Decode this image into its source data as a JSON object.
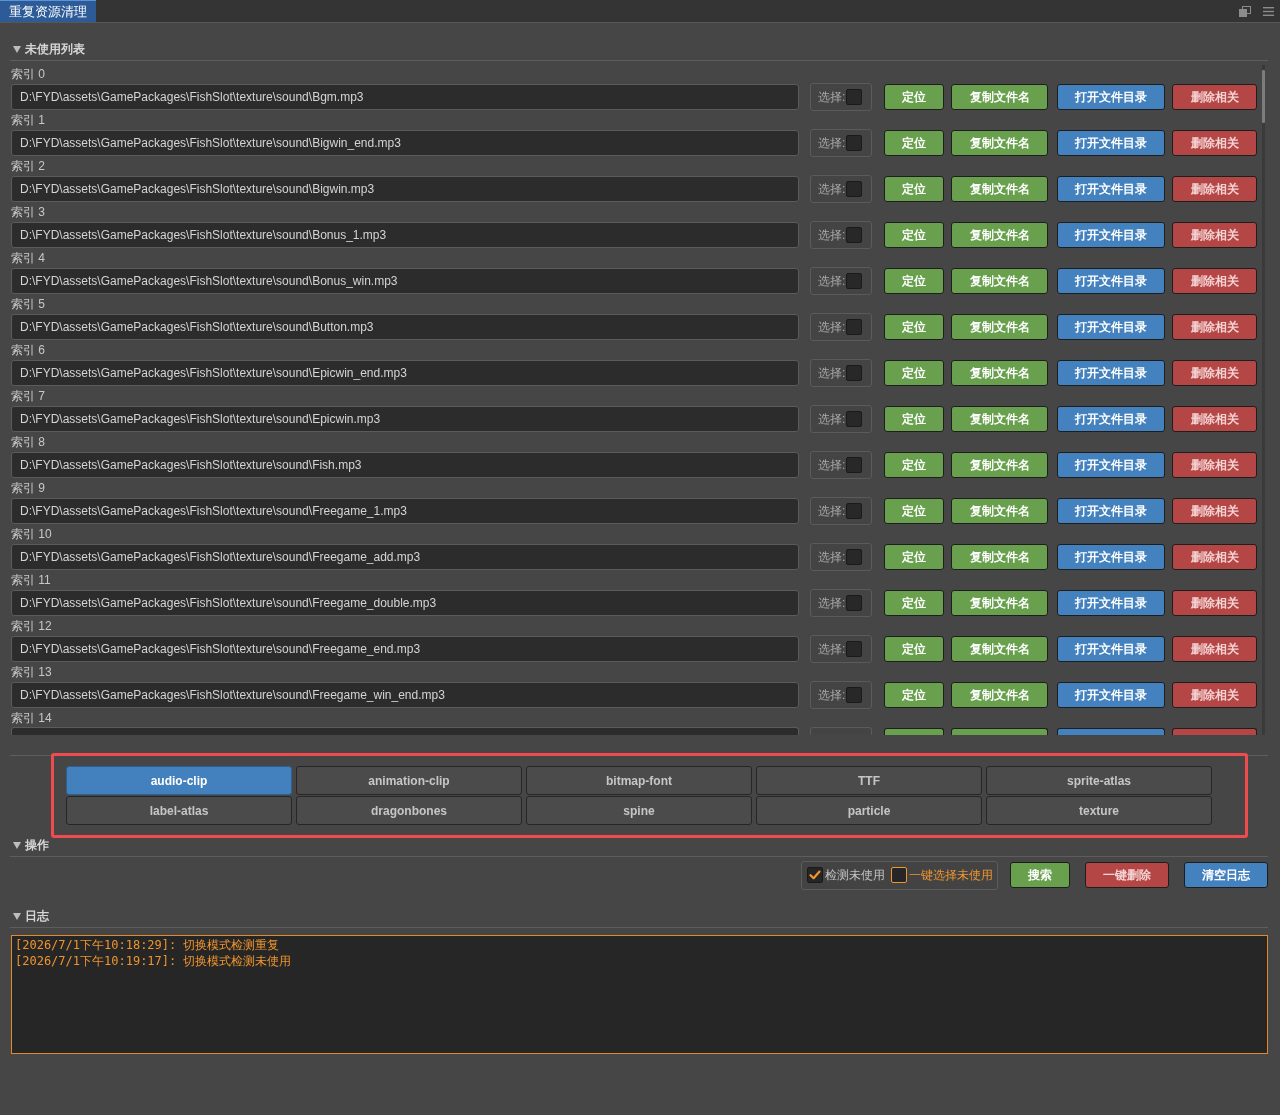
{
  "window": {
    "tabs": [
      {
        "label": "重复资源清理",
        "selected": true
      }
    ]
  },
  "unused_list": {
    "title": "未使用列表",
    "expanded": true,
    "rows": [
      {
        "index": "索引 0",
        "cut_off": false,
        "path": "D:\\FYD\\assets\\GamePackages\\FishSlot\\texture\\sound\\Bgm.mp3",
        "select_label": "选择:",
        "checked": false,
        "buttons": [
          {
            "label": "定位",
            "kind": "locate"
          },
          {
            "label": "复制文件名",
            "kind": "copy_name"
          },
          {
            "label": "打开文件目录",
            "kind": "open_dir"
          },
          {
            "label": "删除相关",
            "kind": "delete_related"
          }
        ]
      },
      {
        "index": "索引 1",
        "cut_off": false,
        "path": "D:\\FYD\\assets\\GamePackages\\FishSlot\\texture\\sound\\Bigwin_end.mp3",
        "select_label": "选择:",
        "checked": false,
        "buttons": [
          {
            "label": "定位",
            "kind": "locate"
          },
          {
            "label": "复制文件名",
            "kind": "copy_name"
          },
          {
            "label": "打开文件目录",
            "kind": "open_dir"
          },
          {
            "label": "删除相关",
            "kind": "delete_related"
          }
        ]
      },
      {
        "index": "索引 2",
        "cut_off": false,
        "path": "D:\\FYD\\assets\\GamePackages\\FishSlot\\texture\\sound\\Bigwin.mp3",
        "select_label": "选择:",
        "checked": false,
        "buttons": [
          {
            "label": "定位",
            "kind": "locate"
          },
          {
            "label": "复制文件名",
            "kind": "copy_name"
          },
          {
            "label": "打开文件目录",
            "kind": "open_dir"
          },
          {
            "label": "删除相关",
            "kind": "delete_related"
          }
        ]
      },
      {
        "index": "索引 3",
        "cut_off": false,
        "path": "D:\\FYD\\assets\\GamePackages\\FishSlot\\texture\\sound\\Bonus_1.mp3",
        "select_label": "选择:",
        "checked": false,
        "buttons": [
          {
            "label": "定位",
            "kind": "locate"
          },
          {
            "label": "复制文件名",
            "kind": "copy_name"
          },
          {
            "label": "打开文件目录",
            "kind": "open_dir"
          },
          {
            "label": "删除相关",
            "kind": "delete_related"
          }
        ]
      },
      {
        "index": "索引 4",
        "cut_off": false,
        "path": "D:\\FYD\\assets\\GamePackages\\FishSlot\\texture\\sound\\Bonus_win.mp3",
        "select_label": "选择:",
        "checked": false,
        "buttons": [
          {
            "label": "定位",
            "kind": "locate"
          },
          {
            "label": "复制文件名",
            "kind": "copy_name"
          },
          {
            "label": "打开文件目录",
            "kind": "open_dir"
          },
          {
            "label": "删除相关",
            "kind": "delete_related"
          }
        ]
      },
      {
        "index": "索引 5",
        "cut_off": false,
        "path": "D:\\FYD\\assets\\GamePackages\\FishSlot\\texture\\sound\\Button.mp3",
        "select_label": "选择:",
        "checked": false,
        "buttons": [
          {
            "label": "定位",
            "kind": "locate"
          },
          {
            "label": "复制文件名",
            "kind": "copy_name"
          },
          {
            "label": "打开文件目录",
            "kind": "open_dir"
          },
          {
            "label": "删除相关",
            "kind": "delete_related"
          }
        ]
      },
      {
        "index": "索引 6",
        "cut_off": false,
        "path": "D:\\FYD\\assets\\GamePackages\\FishSlot\\texture\\sound\\Epicwin_end.mp3",
        "select_label": "选择:",
        "checked": false,
        "buttons": [
          {
            "label": "定位",
            "kind": "locate"
          },
          {
            "label": "复制文件名",
            "kind": "copy_name"
          },
          {
            "label": "打开文件目录",
            "kind": "open_dir"
          },
          {
            "label": "删除相关",
            "kind": "delete_related"
          }
        ]
      },
      {
        "index": "索引 7",
        "cut_off": false,
        "path": "D:\\FYD\\assets\\GamePackages\\FishSlot\\texture\\sound\\Epicwin.mp3",
        "select_label": "选择:",
        "checked": false,
        "buttons": [
          {
            "label": "定位",
            "kind": "locate"
          },
          {
            "label": "复制文件名",
            "kind": "copy_name"
          },
          {
            "label": "打开文件目录",
            "kind": "open_dir"
          },
          {
            "label": "删除相关",
            "kind": "delete_related"
          }
        ]
      },
      {
        "index": "索引 8",
        "cut_off": false,
        "path": "D:\\FYD\\assets\\GamePackages\\FishSlot\\texture\\sound\\Fish.mp3",
        "select_label": "选择:",
        "checked": false,
        "buttons": [
          {
            "label": "定位",
            "kind": "locate"
          },
          {
            "label": "复制文件名",
            "kind": "copy_name"
          },
          {
            "label": "打开文件目录",
            "kind": "open_dir"
          },
          {
            "label": "删除相关",
            "kind": "delete_related"
          }
        ]
      },
      {
        "index": "索引 9",
        "cut_off": false,
        "path": "D:\\FYD\\assets\\GamePackages\\FishSlot\\texture\\sound\\Freegame_1.mp3",
        "select_label": "选择:",
        "checked": false,
        "buttons": [
          {
            "label": "定位",
            "kind": "locate"
          },
          {
            "label": "复制文件名",
            "kind": "copy_name"
          },
          {
            "label": "打开文件目录",
            "kind": "open_dir"
          },
          {
            "label": "删除相关",
            "kind": "delete_related"
          }
        ]
      },
      {
        "index": "索引 10",
        "cut_off": false,
        "path": "D:\\FYD\\assets\\GamePackages\\FishSlot\\texture\\sound\\Freegame_add.mp3",
        "select_label": "选择:",
        "checked": false,
        "buttons": [
          {
            "label": "定位",
            "kind": "locate"
          },
          {
            "label": "复制文件名",
            "kind": "copy_name"
          },
          {
            "label": "打开文件目录",
            "kind": "open_dir"
          },
          {
            "label": "删除相关",
            "kind": "delete_related"
          }
        ]
      },
      {
        "index": "索引 11",
        "cut_off": false,
        "path": "D:\\FYD\\assets\\GamePackages\\FishSlot\\texture\\sound\\Freegame_double.mp3",
        "select_label": "选择:",
        "checked": false,
        "buttons": [
          {
            "label": "定位",
            "kind": "locate"
          },
          {
            "label": "复制文件名",
            "kind": "copy_name"
          },
          {
            "label": "打开文件目录",
            "kind": "open_dir"
          },
          {
            "label": "删除相关",
            "kind": "delete_related"
          }
        ]
      },
      {
        "index": "索引 12",
        "cut_off": false,
        "path": "D:\\FYD\\assets\\GamePackages\\FishSlot\\texture\\sound\\Freegame_end.mp3",
        "select_label": "选择:",
        "checked": false,
        "buttons": [
          {
            "label": "定位",
            "kind": "locate"
          },
          {
            "label": "复制文件名",
            "kind": "copy_name"
          },
          {
            "label": "打开文件目录",
            "kind": "open_dir"
          },
          {
            "label": "删除相关",
            "kind": "delete_related"
          }
        ]
      },
      {
        "index": "索引 13",
        "cut_off": false,
        "path": "D:\\FYD\\assets\\GamePackages\\FishSlot\\texture\\sound\\Freegame_win_end.mp3",
        "select_label": "选择:",
        "checked": false,
        "buttons": [
          {
            "label": "定位",
            "kind": "locate"
          },
          {
            "label": "复制文件名",
            "kind": "copy_name"
          },
          {
            "label": "打开文件目录",
            "kind": "open_dir"
          },
          {
            "label": "删除相关",
            "kind": "delete_related"
          }
        ]
      },
      {
        "index": "索引 14",
        "cut_off": true,
        "buttons": [
          {
            "kind": "locate"
          },
          {
            "kind": "copy_name"
          },
          {
            "kind": "open_dir"
          },
          {
            "kind": "delete_related"
          }
        ]
      }
    ]
  },
  "type_filter": {
    "tabs": [
      {
        "label": "audio-clip",
        "selected": true
      },
      {
        "label": "animation-clip",
        "selected": false
      },
      {
        "label": "bitmap-font",
        "selected": false
      },
      {
        "label": "TTF",
        "selected": false
      },
      {
        "label": "sprite-atlas",
        "selected": false
      },
      {
        "label": "label-atlas",
        "selected": false
      },
      {
        "label": "dragonbones",
        "selected": false
      },
      {
        "label": "spine",
        "selected": false
      },
      {
        "label": "particle",
        "selected": false
      },
      {
        "label": "texture",
        "selected": false
      }
    ]
  },
  "operations": {
    "title": "操作",
    "expanded": true,
    "options": [
      {
        "label": "检测未使用",
        "checked": true,
        "hovered": false
      },
      {
        "label": "一键选择未使用",
        "checked": false,
        "hovered": true
      }
    ],
    "buttons": [
      {
        "label": "搜索",
        "kind": "search"
      },
      {
        "label": "一键删除",
        "kind": "delete_all"
      },
      {
        "label": "清空日志",
        "kind": "clear_log"
      }
    ]
  },
  "log": {
    "title": "日志",
    "expanded": true,
    "focused": true,
    "lines": [
      "[2026/7/1下午10:18:29]: 切换模式检测重复",
      "[2026/7/1下午10:19:17]: 切换模式检测未使用"
    ]
  }
}
